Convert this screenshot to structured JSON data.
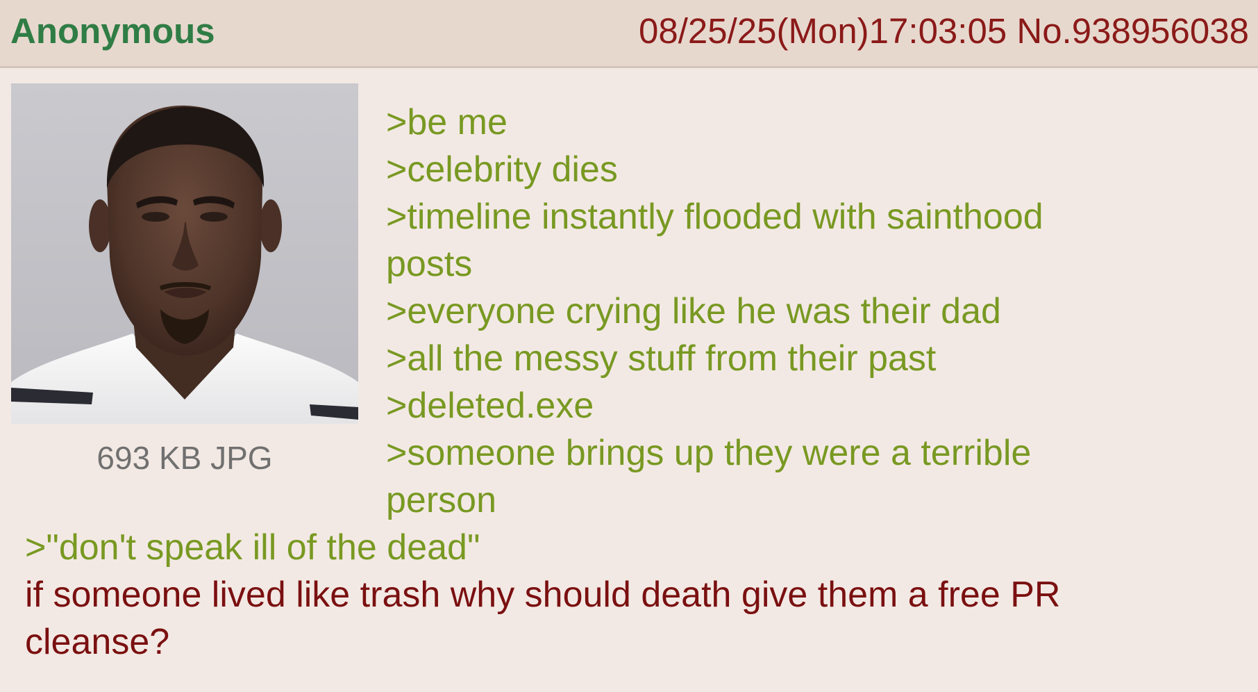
{
  "header": {
    "name": "Anonymous",
    "meta": "08/25/25(Mon)17:03:05 No.938956038"
  },
  "file": {
    "info": "693 KB JPG"
  },
  "body": {
    "lines": [
      ">be me",
      ">celebrity dies",
      ">timeline instantly flooded with sainthood",
      "posts",
      ">everyone crying like he was their dad",
      ">all the messy stuff from their past",
      ">deleted.exe",
      ">someone brings up they were a terrible",
      "person",
      ">\"don't speak ill of the dead\"",
      "if someone lived like trash why should death give them a free PR",
      "cleanse?"
    ]
  },
  "colors": {
    "background": "#f3e9e4",
    "header_background": "#e7d8ce",
    "name": "#2f7d45",
    "meta": "#8a1a18",
    "greentext": "#789922",
    "plain_text": "#7a1010",
    "file_info": "#707070"
  }
}
